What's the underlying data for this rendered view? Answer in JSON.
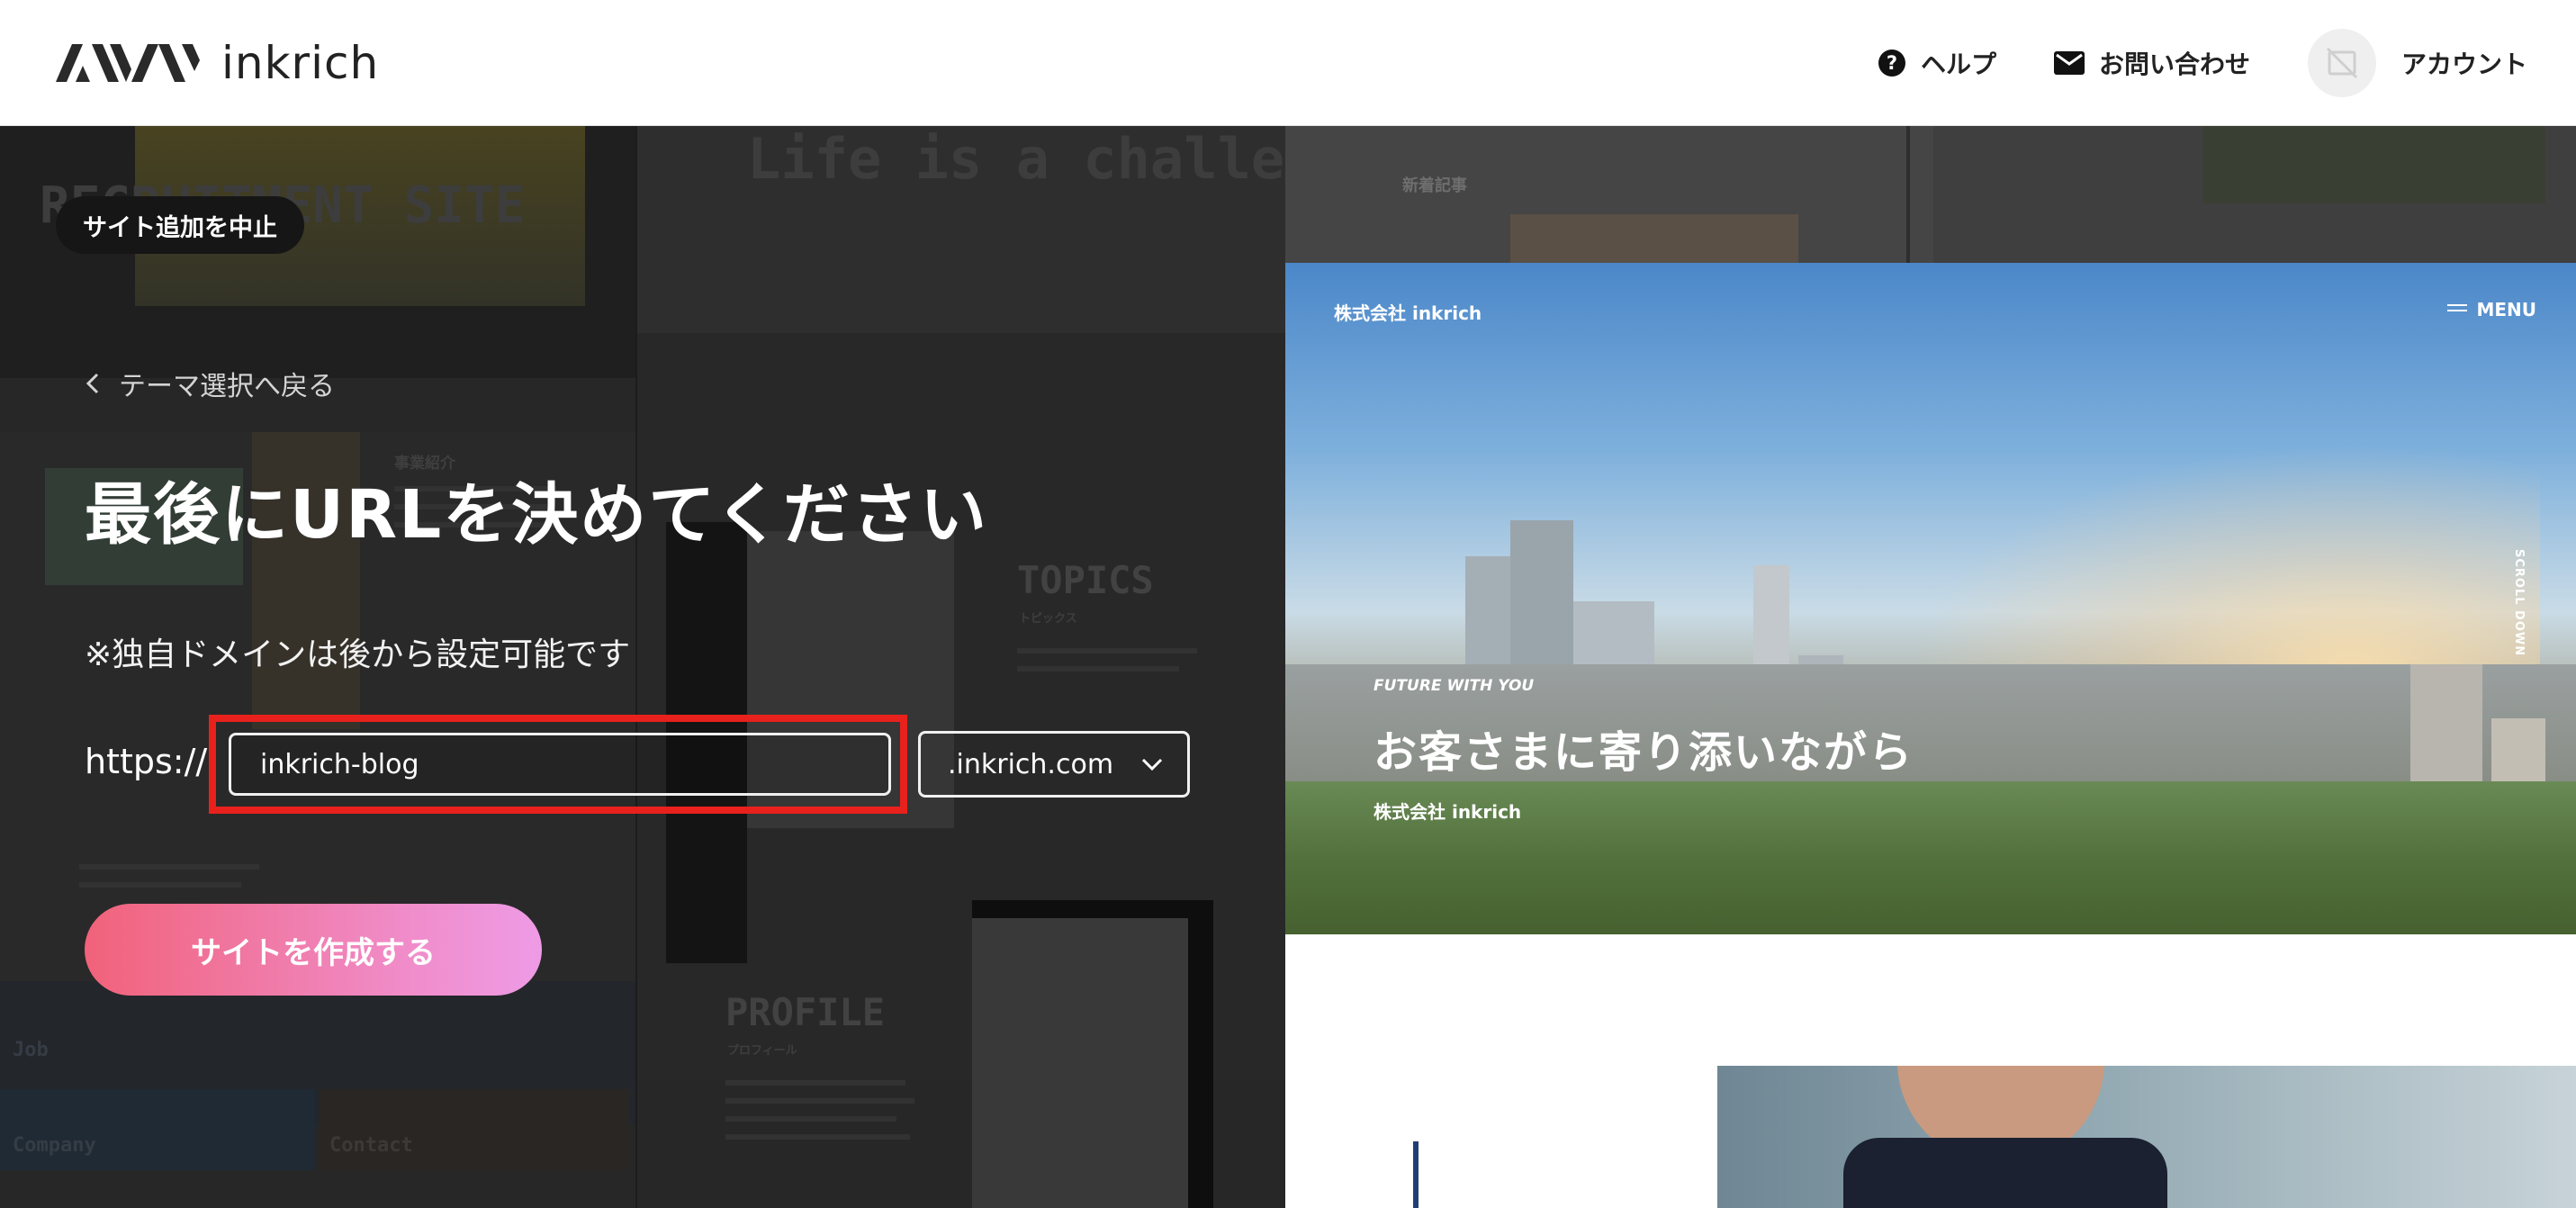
{
  "header": {
    "logo_text": "inkrich",
    "help_label": "ヘルプ",
    "contact_label": "お問い合わせ",
    "account_label": "アカウント"
  },
  "background_collage": {
    "recruitment": "RECRUITMENT SITE",
    "challenge": "Life is a challenge.",
    "topics": "TOPICS",
    "topics_sub": "トピックス",
    "profile": "PROFILE",
    "profile_sub": "プロフィール",
    "jigyo": "事業紹介",
    "news": "新着記事",
    "job": "Job",
    "company": "Company",
    "contact": "Contact"
  },
  "setup": {
    "cancel_label": "サイト追加を中止",
    "back_label": "テーマ選択へ戻る",
    "title": "最後にURLを決めてください",
    "note": "※独自ドメインは後から設定可能です",
    "url_prefix": "https://",
    "subdomain_value": "inkrich-blog",
    "domain_selected": ".inkrich.com",
    "create_button": "サイトを作成する"
  },
  "preview": {
    "company": "株式会社 inkrich",
    "menu": "MENU",
    "scroll": "SCROLL DOWN",
    "tagline": "FUTURE WITH YOU",
    "headline": "お客さまに寄り添いながら",
    "sub": "株式会社 inkrich"
  },
  "colors": {
    "highlight": "#e8211d",
    "button_start": "#f1627a",
    "button_end": "#ee9be6",
    "accent_bar": "#1f3f74"
  },
  "icons": {
    "help": "help-circle-icon",
    "mail": "mail-icon",
    "avatar": "no-image-icon",
    "back": "chevron-left-icon",
    "select": "chevron-down-icon",
    "menu": "hamburger-icon"
  }
}
